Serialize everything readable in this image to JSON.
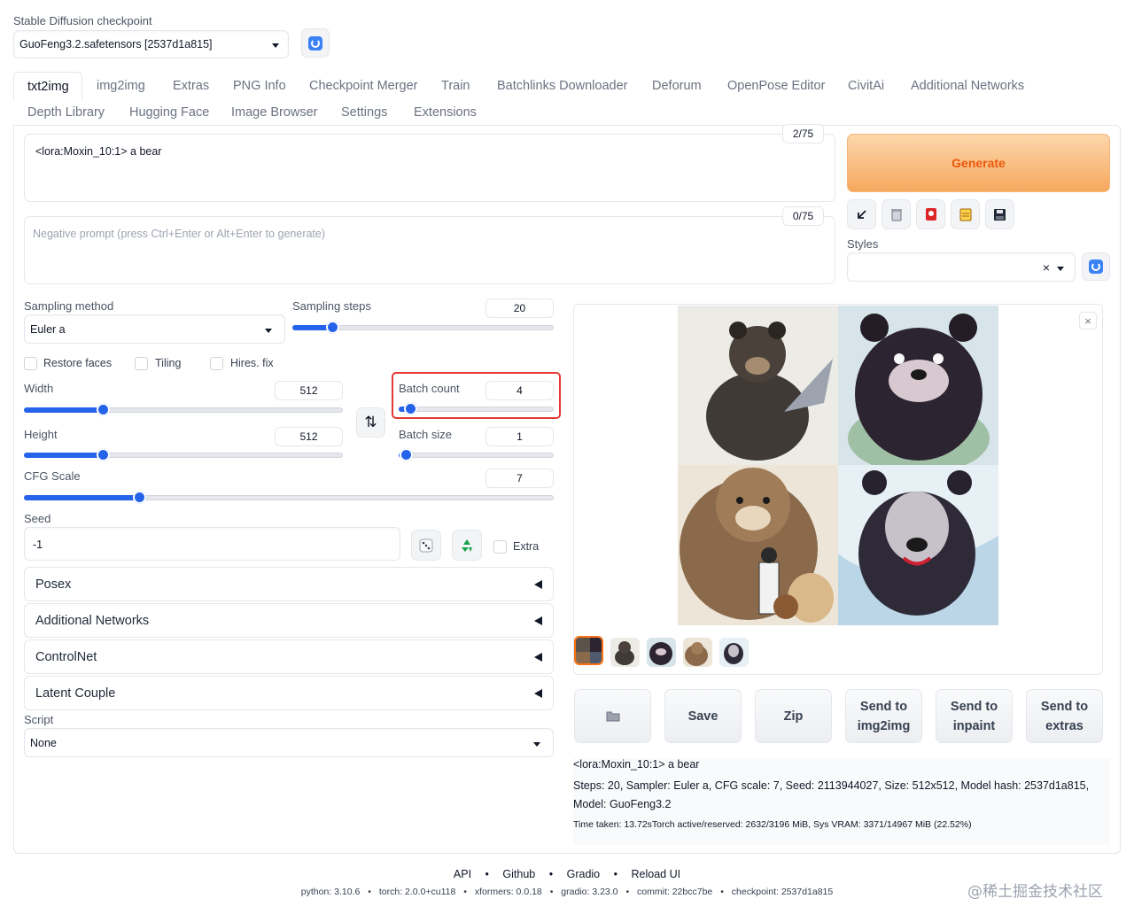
{
  "checkpoint": {
    "label": "Stable Diffusion checkpoint",
    "value": "GuoFeng3.2.safetensors [2537d1a815]"
  },
  "tabs": {
    "row1": [
      "txt2img",
      "img2img",
      "Extras",
      "PNG Info",
      "Checkpoint Merger",
      "Train",
      "Batchlinks Downloader",
      "Deforum",
      "OpenPose Editor",
      "CivitAi",
      "Additional Networks"
    ],
    "row2": [
      "Depth Library",
      "Hugging Face",
      "Image Browser",
      "Settings",
      "Extensions"
    ],
    "active": "txt2img"
  },
  "prompt": {
    "text": "<lora:Moxin_10:1> a bear",
    "counter": "2/75"
  },
  "negative": {
    "placeholder": "Negative prompt (press Ctrl+Enter or Alt+Enter to generate)",
    "counter": "0/75"
  },
  "generate_label": "Generate",
  "styles": {
    "label": "Styles",
    "clear": "×"
  },
  "sampling_method": {
    "label": "Sampling method",
    "value": "Euler a"
  },
  "sampling_steps": {
    "label": "Sampling steps",
    "value": "20",
    "fraction": 0.133
  },
  "checks": {
    "restore": "Restore faces",
    "tiling": "Tiling",
    "hires": "Hires. fix"
  },
  "width": {
    "label": "Width",
    "value": "512",
    "fraction": 0.235
  },
  "height": {
    "label": "Height",
    "value": "512",
    "fraction": 0.235
  },
  "swap_icon": "⇅",
  "batch_count": {
    "label": "Batch count",
    "value": "4",
    "fraction": 0.03
  },
  "batch_size": {
    "label": "Batch size",
    "value": "1",
    "fraction": 0.0
  },
  "cfg": {
    "label": "CFG Scale",
    "value": "7",
    "fraction": 0.21
  },
  "seed": {
    "label": "Seed",
    "value": "-1",
    "extra": "Extra"
  },
  "accordions": [
    "Posex",
    "Additional Networks",
    "ControlNet",
    "Latent Couple"
  ],
  "script": {
    "label": "Script",
    "value": "None"
  },
  "actions": {
    "save": "Save",
    "zip": "Zip",
    "img2img": "Send to img2img",
    "inpaint": "Send to inpaint",
    "extras": "Send to extras"
  },
  "close_glyph": "×",
  "info": {
    "prompt": "<lora:Moxin_10:1> a bear",
    "params": "Steps: 20, Sampler: Euler a, CFG scale: 7, Seed: 2113944027, Size: 512x512, Model hash: 2537d1a815, Model: GuoFeng3.2",
    "time": "Time taken: 13.72sTorch active/reserved: 2632/3196 MiB, Sys VRAM: 3371/14967 MiB (22.52%)"
  },
  "footer": {
    "links": [
      "API",
      "Github",
      "Gradio",
      "Reload UI"
    ],
    "sep": "•",
    "versions": [
      "python: 3.10.6",
      "torch: 2.0.0+cu118",
      "xformers: 0.0.18",
      "gradio: 3.23.0",
      "commit: 22bcc7be",
      "checkpoint: 2537d1a815"
    ],
    "watermark": "@稀土掘金技术社区"
  },
  "colors": {
    "accent": "#2563eb",
    "generate": "#f59e4c",
    "highlight": "#e53935"
  }
}
